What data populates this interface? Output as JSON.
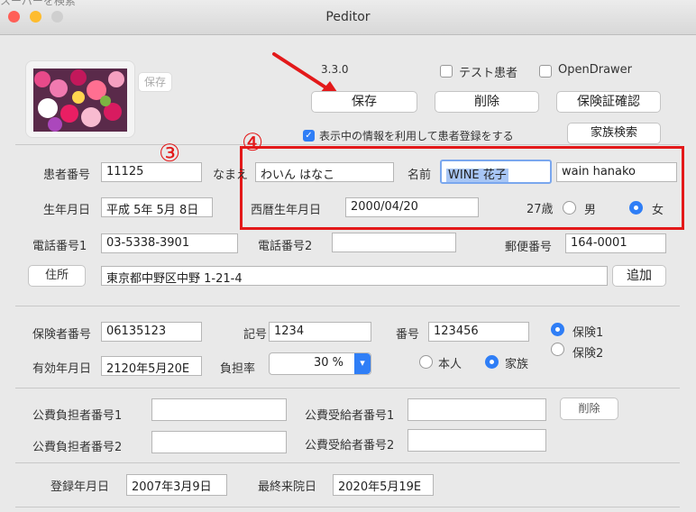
{
  "window": {
    "title": "Peditor",
    "ghost_text": "スーパーを検索"
  },
  "colors": {
    "accent": "#2f7ef6",
    "annotation": "#e3191a",
    "close": "#ff5f57",
    "minimize": "#febc2e"
  },
  "photo_save_label": "保存",
  "version": "3.3.0",
  "test_patient_label": "テスト患者",
  "opendrawer_label": "OpenDrawer",
  "buttons": {
    "save": "保存",
    "delete": "削除",
    "insurance_check": "保険証確認",
    "family_search": "家族検索",
    "address": "住所",
    "add": "追加",
    "public_delete": "削除"
  },
  "use_info_label": "表示中の情報を利用して患者登録をする",
  "annotations": {
    "three": "③",
    "four": "④"
  },
  "patient": {
    "number_label": "患者番号",
    "number": "11125",
    "kana_label": "なまえ",
    "kana": "わいん はなこ",
    "name_label": "名前",
    "name": "WINE 花子",
    "romaji": "wain hanako",
    "birth_label": "生年月日",
    "birth": "平成 5年 5月 8日",
    "western_birth_label": "西暦生年月日",
    "western_birth": "2000/04/20",
    "age": "27歳",
    "male": "男",
    "female": "女",
    "phone1_label": "電話番号1",
    "phone1": "03-5338-3901",
    "phone2_label": "電話番号2",
    "phone2": "",
    "postal_label": "郵便番号",
    "postal": "164-0001",
    "address": "東京都中野区中野 1-21-4"
  },
  "insurance": {
    "insurer_label": "保険者番号",
    "insurer": "06135123",
    "symbol_label": "記号",
    "symbol": "1234",
    "num_label": "番号",
    "num": "123456",
    "ins1": "保険1",
    "ins2": "保険2",
    "valid_label": "有効年月日",
    "valid": "2120年5月20E",
    "burden_label": "負担率",
    "burden": "30 %",
    "self": "本人",
    "family": "家族"
  },
  "public_expense": {
    "payer1_label": "公費負担者番号1",
    "recipient1_label": "公費受給者番号1",
    "payer2_label": "公費負担者番号2",
    "recipient2_label": "公費受給者番号2",
    "payer1": "",
    "recipient1": "",
    "payer2": "",
    "recipient2": ""
  },
  "dates": {
    "registered_label": "登録年月日",
    "registered": "2007年3月9日",
    "last_visit_label": "最終来院日",
    "last_visit": "2020年5月19E"
  }
}
